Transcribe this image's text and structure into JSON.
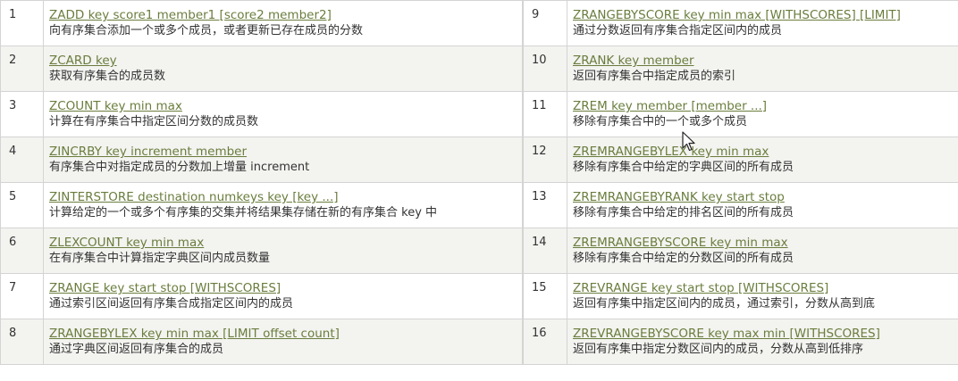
{
  "left_rows": [
    {
      "num": "1",
      "command": "ZADD key score1 member1 [score2 member2]",
      "description": "向有序集合添加一个或多个成员，或者更新已存在成员的分数"
    },
    {
      "num": "2",
      "command": "ZCARD key",
      "description": "获取有序集合的成员数"
    },
    {
      "num": "3",
      "command": "ZCOUNT key min max",
      "description": "计算在有序集合中指定区间分数的成员数"
    },
    {
      "num": "4",
      "command": "ZINCRBY key increment member",
      "description": "有序集合中对指定成员的分数加上增量 increment"
    },
    {
      "num": "5",
      "command": "ZINTERSTORE destination numkeys key [key ...]",
      "description": "计算给定的一个或多个有序集的交集并将结果集存储在新的有序集合 key 中"
    },
    {
      "num": "6",
      "command": "ZLEXCOUNT key min max",
      "description": "在有序集合中计算指定字典区间内成员数量"
    },
    {
      "num": "7",
      "command": "ZRANGE key start stop [WITHSCORES]",
      "description": "通过索引区间返回有序集合成指定区间内的成员"
    },
    {
      "num": "8",
      "command": "ZRANGEBYLEX key min max [LIMIT offset count]",
      "description": "通过字典区间返回有序集合的成员"
    }
  ],
  "right_rows": [
    {
      "num": "9",
      "command": "ZRANGEBYSCORE key min max [WITHSCORES] [LIMIT]",
      "description": "通过分数返回有序集合指定区间内的成员"
    },
    {
      "num": "10",
      "command": "ZRANK key member",
      "description": "返回有序集合中指定成员的索引"
    },
    {
      "num": "11",
      "command": "ZREM key member [member ...]",
      "description": "移除有序集合中的一个或多个成员"
    },
    {
      "num": "12",
      "command": "ZREMRANGEBYLEX key min max",
      "description": "移除有序集合中给定的字典区间的所有成员"
    },
    {
      "num": "13",
      "command": "ZREMRANGEBYRANK key start stop",
      "description": "移除有序集合中给定的排名区间的所有成员"
    },
    {
      "num": "14",
      "command": "ZREMRANGEBYSCORE key min max",
      "description": "移除有序集合中给定的分数区间的所有成员"
    },
    {
      "num": "15",
      "command": "ZREVRANGE key start stop [WITHSCORES]",
      "description": "返回有序集中指定区间内的成员，通过索引，分数从高到底"
    },
    {
      "num": "16",
      "command": "ZREVRANGEBYSCORE key max min [WITHSCORES]",
      "description": "返回有序集中指定分数区间内的成员，分数从高到低排序"
    }
  ],
  "colors": {
    "link": "#6a7d3d",
    "row_alt": "#f3f3f0",
    "border": "#d4d4d4"
  },
  "icons": {
    "cursor": "mouse-pointer-icon"
  }
}
